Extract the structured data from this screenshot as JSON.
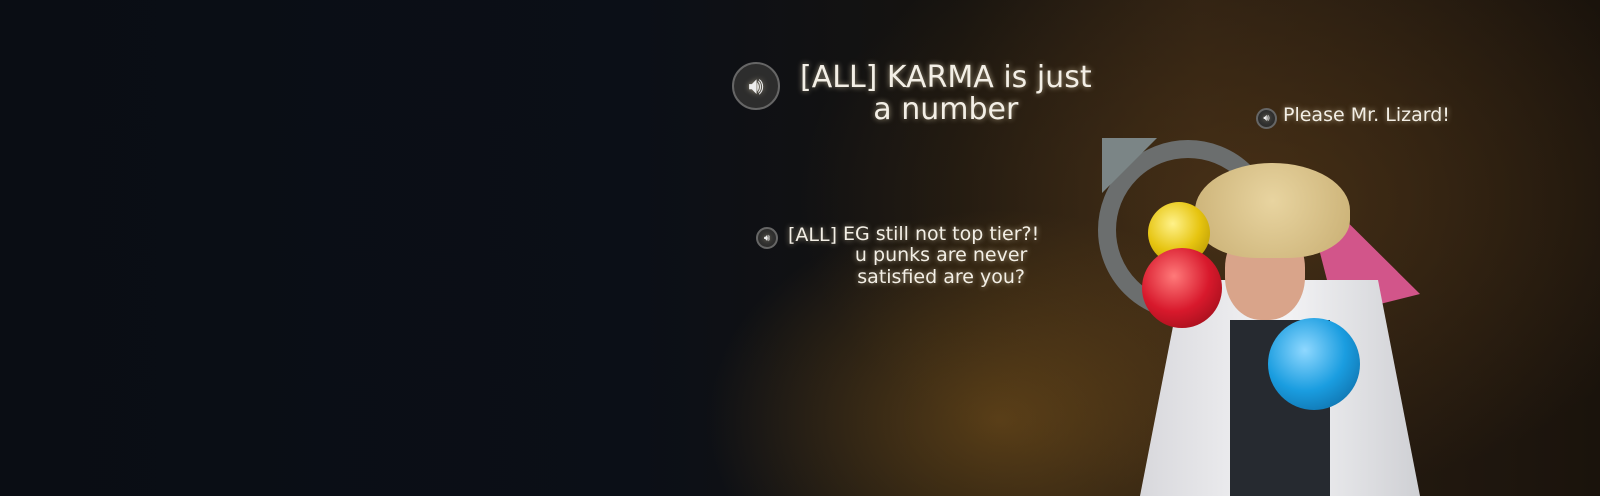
{
  "chats": [
    {
      "prefix": "[ALL]",
      "text": "[ALL] KARMA is just\na number",
      "icon": "speaker-icon"
    },
    {
      "text": "Please Mr. Lizard!",
      "icon": "speaker-icon"
    },
    {
      "prefix": "[ALL]",
      "text": "EG still not top tier?!\nu punks are never\nsatisfied are you?",
      "icon": "speaker-icon"
    }
  ],
  "colors": {
    "text": "#f3efe6",
    "ball_yellow": "#e6c410",
    "ball_red": "#d8192c",
    "ball_blue": "#1a9de0"
  }
}
